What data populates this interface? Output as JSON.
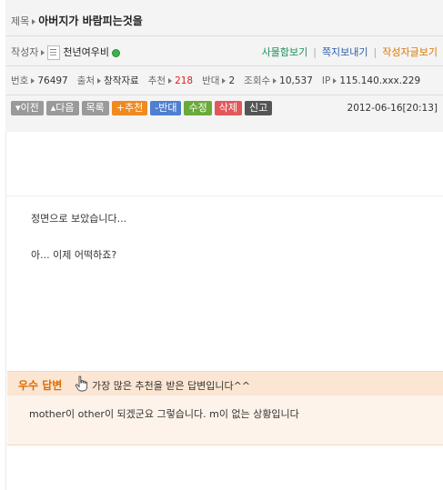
{
  "post": {
    "title_label": "제목",
    "title": "아버지가 바람피는것을",
    "author_label": "작성자",
    "author": "천년여우비",
    "links": [
      "사물함보기",
      "쪽지보내기",
      "작성자글보기"
    ],
    "meta": {
      "number_label": "번호",
      "number": "76497",
      "source_label": "출처",
      "source": "창작자료",
      "recommend_label": "추천",
      "recommend": "218",
      "oppose_label": "반대",
      "oppose": "2",
      "views_label": "조회수",
      "views": "10,537",
      "ip_label": "IP",
      "ip": "115.140.xxx.229"
    },
    "buttons": {
      "prev": "▾이전",
      "next": "▴다음",
      "list": "목록",
      "recommend": "+추천",
      "oppose": "-반대",
      "edit": "수정",
      "delete": "삭제",
      "report": "신고"
    },
    "datetime": "2012-06-16[20:13]"
  },
  "body": {
    "line1": "정면으로 보았습니다...",
    "line2": "아... 이제 어떡하죠?"
  },
  "best_answer": {
    "label": "우수 답변",
    "icon": "hand-pointer-icon",
    "description": "가장 많은 추천을 받은 답변입니다^^",
    "text": "mother이 other이 되겠군요 그렇습니다. m이 없는 상황입니다"
  },
  "colors": {
    "accent_orange": "#e06a00",
    "recommend_red": "#dd2222",
    "link_green": "#19905a",
    "link_blue": "#2a5fa8"
  }
}
